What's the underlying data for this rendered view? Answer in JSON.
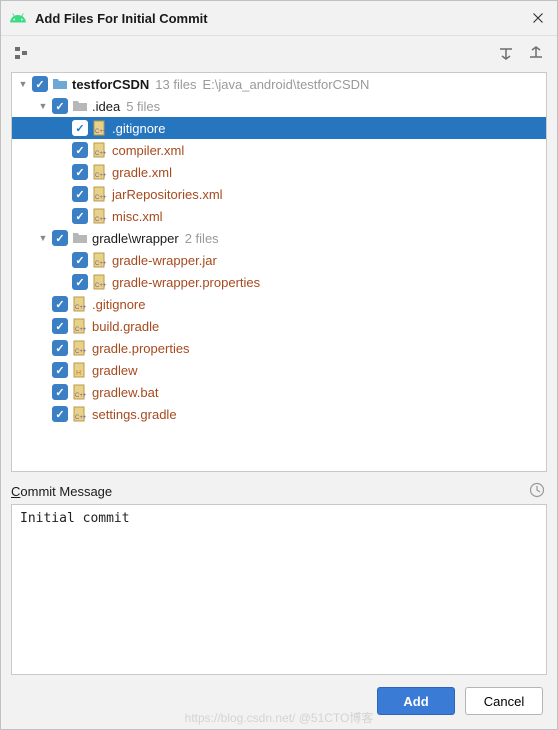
{
  "dialog": {
    "title": "Add Files For Initial Commit"
  },
  "tree": {
    "root": {
      "name": "testforCSDN",
      "meta_count": "13 files",
      "meta_path": "E:\\java_android\\testforCSDN"
    },
    "folders": [
      {
        "name": ".idea",
        "count": "5 files",
        "files": [
          ".gitignore",
          "compiler.xml",
          "gradle.xml",
          "jarRepositories.xml",
          "misc.xml"
        ],
        "selected_index": 0
      },
      {
        "name": "gradle\\wrapper",
        "count": "2 files",
        "files": [
          "gradle-wrapper.jar",
          "gradle-wrapper.properties"
        ]
      }
    ],
    "root_files": [
      ".gitignore",
      "build.gradle",
      "gradle.properties",
      "gradlew",
      "gradlew.bat",
      "settings.gradle"
    ]
  },
  "commit": {
    "label_prefix": "C",
    "label_rest": "ommit Message",
    "message": "Initial commit"
  },
  "buttons": {
    "add": "Add",
    "cancel": "Cancel"
  },
  "watermark": "https://blog.csdn.net/  @51CTO博客"
}
